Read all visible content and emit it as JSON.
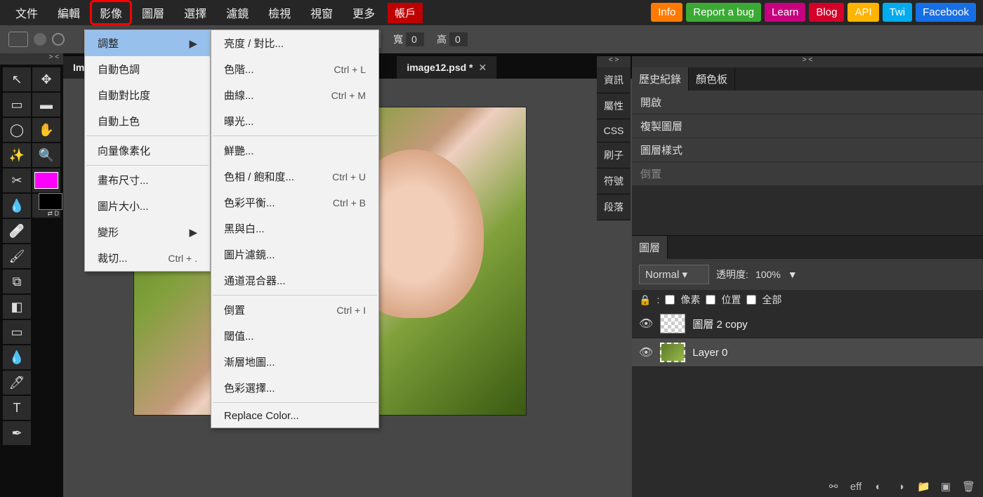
{
  "menubar": {
    "items": [
      "文件",
      "編輯",
      "影像",
      "圖層",
      "選擇",
      "濾鏡",
      "檢視",
      "視窗",
      "更多"
    ],
    "highlighted_index": 2,
    "account": "帳戶",
    "ext": {
      "info": "Info",
      "report": "Report a bug",
      "learn": "Learn",
      "blog": "Blog",
      "api": "API",
      "twi": "Twi",
      "fb": "Facebook"
    }
  },
  "optbar": {
    "width_label": "寬",
    "width_val": "0",
    "height_label": "高",
    "height_val": "0"
  },
  "submenu1": {
    "items": [
      {
        "label": "調整",
        "arrow": true,
        "hover": true
      },
      {
        "label": "自動色調"
      },
      {
        "label": "自動對比度"
      },
      {
        "label": "自動上色"
      },
      {
        "sep": true
      },
      {
        "label": "向量像素化"
      },
      {
        "sep": true
      },
      {
        "label": "畫布尺寸..."
      },
      {
        "label": "圖片大小..."
      },
      {
        "label": "變形",
        "arrow": true
      },
      {
        "label": "裁切...",
        "sc": "Ctrl + ."
      }
    ]
  },
  "submenu2": {
    "items": [
      {
        "label": "亮度 / 對比..."
      },
      {
        "label": "色階...",
        "sc": "Ctrl + L"
      },
      {
        "label": "曲線...",
        "sc": "Ctrl + M"
      },
      {
        "label": "曝光..."
      },
      {
        "sep": true
      },
      {
        "label": "鮮艷..."
      },
      {
        "label": "色相 / 飽和度...",
        "sc": "Ctrl + U"
      },
      {
        "label": "色彩平衡...",
        "sc": "Ctrl + B"
      },
      {
        "label": "黑與白..."
      },
      {
        "label": "圖片濾鏡..."
      },
      {
        "label": "通道混合器..."
      },
      {
        "sep": true
      },
      {
        "label": "倒置",
        "sc": "Ctrl + I"
      },
      {
        "label": "閾值..."
      },
      {
        "label": "漸層地圖..."
      },
      {
        "label": "色彩選擇..."
      },
      {
        "sep": true
      },
      {
        "label": "Replace Color..."
      }
    ]
  },
  "tabs": [
    {
      "name": "Im",
      "close": false
    },
    {
      "name": "image12.psd *",
      "close": true
    }
  ],
  "right_collapsed": [
    "資訊",
    "屬性",
    "CSS",
    "刷子",
    "符號",
    "段落"
  ],
  "history": {
    "tabs": [
      "歷史紀錄",
      "顏色板"
    ],
    "active": 0,
    "items": [
      {
        "label": "開啟"
      },
      {
        "label": "複製圖層"
      },
      {
        "label": "圖層樣式"
      },
      {
        "label": "倒置",
        "dim": true
      }
    ]
  },
  "layers": {
    "tab": "圖層",
    "mode": "Normal",
    "opacity_label": "透明度:",
    "opacity_val": "100%",
    "lock_label": ":",
    "lock_pixel": "像素",
    "lock_pos": "位置",
    "lock_all": "全部",
    "rows": [
      {
        "name": "圖層 2 copy",
        "chk": true
      },
      {
        "name": "Layer 0",
        "sel": true
      }
    ],
    "footer_eff": "eff"
  },
  "tools_glyphs": [
    "↖",
    "✥",
    "▭",
    "▬",
    "◯",
    "✋",
    "✎",
    "🔍",
    "✂",
    "",
    "💧",
    "",
    "✏",
    "",
    "🖌",
    "",
    "👤",
    "",
    "🩹",
    "",
    "▭",
    "",
    "💧",
    "",
    "🖊",
    "",
    "T",
    "",
    "✒",
    ""
  ],
  "swap_label": "⇄ D",
  "collapse_left": "> <",
  "collapse_right": "< >",
  "expand_right": "> <"
}
